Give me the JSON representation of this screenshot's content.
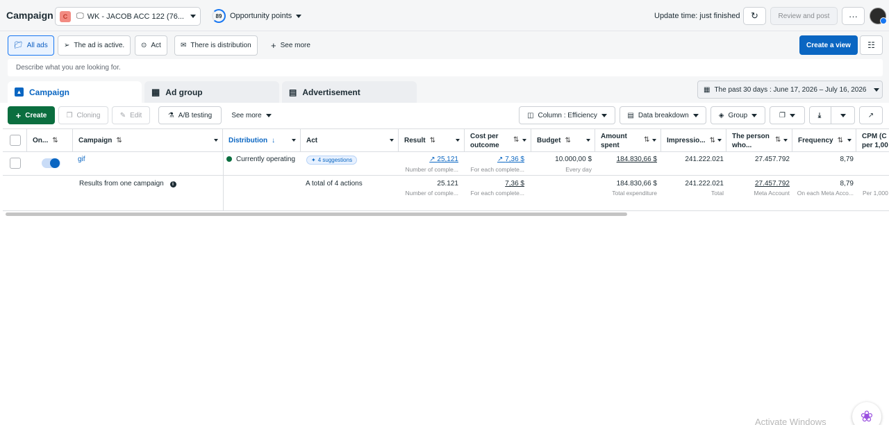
{
  "header": {
    "title": "Campaign",
    "account_badge": "C",
    "account_name": "WK - JACOB ACC 122 (76...",
    "opportunity_score": "89",
    "opportunity_label": "Opportunity points",
    "update_time": "Update time: just finished",
    "review_label": "Review and post",
    "more_label": "···"
  },
  "filters": {
    "chips": [
      "All ads",
      "The ad is active.",
      "Act",
      "There is distribution"
    ],
    "see_more": "See more",
    "create_view": "Create a view"
  },
  "search": {
    "placeholder": "Describe what you are looking for."
  },
  "tabs": [
    "Campaign",
    "Ad group",
    "Advertisement"
  ],
  "date_range": "The past 30 days : June 17, 2026 – July 16, 2026",
  "toolbar": {
    "create": "Create",
    "cloning": "Cloning",
    "edit": "Edit",
    "ab_testing": "A/B testing",
    "see_more": "See more",
    "column": "Column : Efficiency",
    "data_breakdown": "Data breakdown",
    "group": "Group"
  },
  "table": {
    "headers": {
      "on": "On...",
      "campaign": "Campaign",
      "distribution": "Distribution",
      "act": "Act",
      "result": "Result",
      "cost_line1": "Cost per",
      "cost_line2": "outcome",
      "budget": "Budget",
      "spent_line1": "Amount",
      "spent_line2": "spent",
      "impressions": "Impressio...",
      "person_line1": "The person",
      "person_line2": "who...",
      "frequency": "Frequency",
      "cpm_line1": "CPM (C",
      "cpm_line2": "per 1,00"
    },
    "row": {
      "campaign": "gif",
      "distribution": "Currently operating",
      "suggestions": "4 suggestions",
      "result": "25,121",
      "result_sub": "Number of comple...",
      "cost": "7,36 $",
      "cost_sub": "For each complete...",
      "budget": "10.000,00 $",
      "budget_sub": "Every day",
      "spent": "184.830,66 $",
      "impressions": "241.222.021",
      "person": "27.457.792",
      "frequency": "8,79"
    },
    "summary": {
      "label": "Results from one campaign",
      "act": "A total of 4 actions",
      "result": "25.121",
      "result_sub": "Number of comple...",
      "cost": "7,36 $",
      "cost_sub": "For each complete...",
      "spent": "184.830,66 $",
      "spent_sub": "Total expenditure",
      "impressions": "241.222.021",
      "impressions_sub": "Total",
      "person": "27.457.792",
      "person_sub": "Meta Account",
      "frequency": "8,79",
      "frequency_sub": "On each Meta Acco...",
      "cpm_sub": "Per 1,000"
    }
  },
  "watermark": "Activate Windows",
  "colors": {
    "accent": "#0a66c2",
    "create_green": "#0b6e3f",
    "status_green": "#0b6e3f"
  }
}
